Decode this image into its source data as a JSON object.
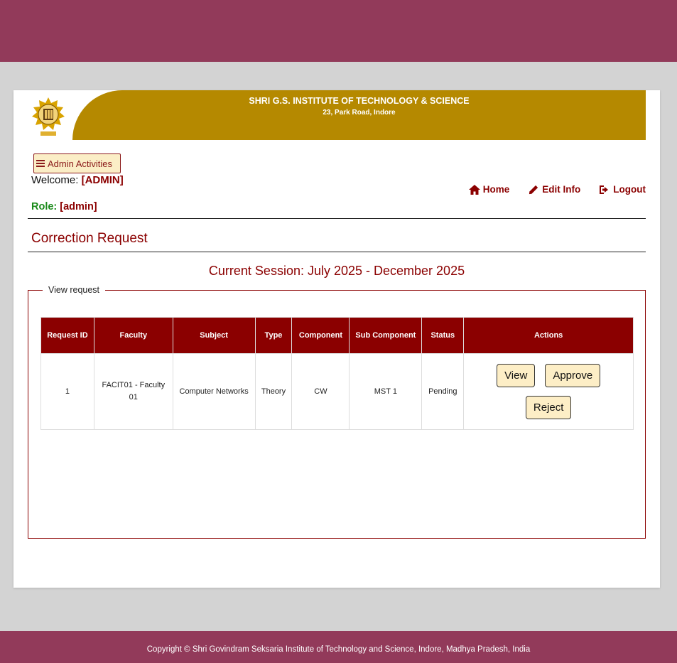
{
  "header": {
    "institute_name": "SHRI G.S. INSTITUTE OF TECHNOLOGY & SCIENCE",
    "address": "23, Park Road, Indore",
    "logo_icon": "institute-seal-icon"
  },
  "user": {
    "admin_menu_label": "Admin Activities",
    "welcome_label": "Welcome:",
    "welcome_name": "[ADMIN]",
    "role_label": "Role:",
    "role_value": "[admin]"
  },
  "nav": {
    "home": "Home",
    "edit_info": "Edit Info",
    "logout": "Logout"
  },
  "page": {
    "title": "Correction Request",
    "session": "Current Session: July 2025 - December 2025",
    "fieldset_legend": "View request"
  },
  "table": {
    "headers": [
      "Request ID",
      "Faculty",
      "Subject",
      "Type",
      "Component",
      "Sub Component",
      "Status",
      "Actions"
    ],
    "rows": [
      {
        "request_id": "1",
        "faculty": "FACIT01 - Faculty 01",
        "subject": "Computer Networks",
        "type": "Theory",
        "component": "CW",
        "sub_component": "MST 1",
        "status": "Pending"
      }
    ],
    "actions": {
      "view": "View",
      "approve": "Approve",
      "reject": "Reject"
    }
  },
  "footer": {
    "copyright": "Copyright © Shri Govindram Seksaria Institute of Technology and Science, Indore, Madhya Pradesh, India"
  },
  "colors": {
    "maroon": "#8b0000",
    "band": "#923a5a",
    "banner_gold": "#b58900",
    "button_bg": "#fdeec6"
  }
}
